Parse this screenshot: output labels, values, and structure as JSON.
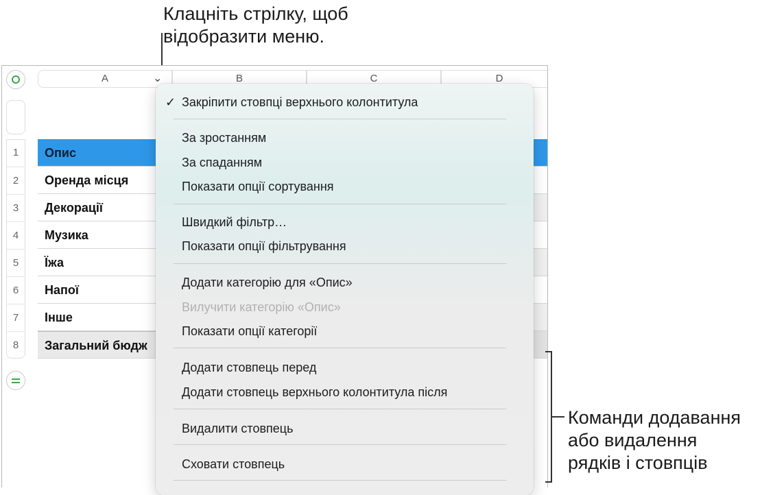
{
  "callouts": {
    "top_line1": "Клацніть стрілку, щоб",
    "top_line2": "відобразити меню.",
    "right_line1": "Команди додавання",
    "right_line2": "або видалення",
    "right_line3": "рядків і стовпців"
  },
  "columns": [
    "A",
    "B",
    "C",
    "D"
  ],
  "rows": [
    {
      "num": "1",
      "label": "Опис"
    },
    {
      "num": "2",
      "label": "Оренда місця"
    },
    {
      "num": "3",
      "label": "Декорації"
    },
    {
      "num": "4",
      "label": "Музика"
    },
    {
      "num": "5",
      "label": "Їжа"
    },
    {
      "num": "6",
      "label": "Напої"
    },
    {
      "num": "7",
      "label": "Інше"
    },
    {
      "num": "8",
      "label": "Загальний бюдж"
    }
  ],
  "menu": {
    "check_mark": "✓",
    "freeze": "Закріпити стовпці верхнього колонтитула",
    "sort_asc": "За зростанням",
    "sort_desc": "За спаданням",
    "sort_options": "Показати опції сортування",
    "quick_filter": "Швидкий фільтр…",
    "filter_options": "Показати опції фільтрування",
    "add_category": "Додати категорію для «Опис»",
    "remove_category": "Вилучити категорію «Опис»",
    "category_options": "Показати опції категорії",
    "add_col_before": "Додати стовпець перед",
    "add_col_after": "Додати стовпець верхнього колонтитула після",
    "delete_col": "Видалити стовпець",
    "hide_col": "Сховати стовпець"
  },
  "colors": {
    "header_row": "#2f97e8",
    "accent_green": "#3aa84a"
  }
}
